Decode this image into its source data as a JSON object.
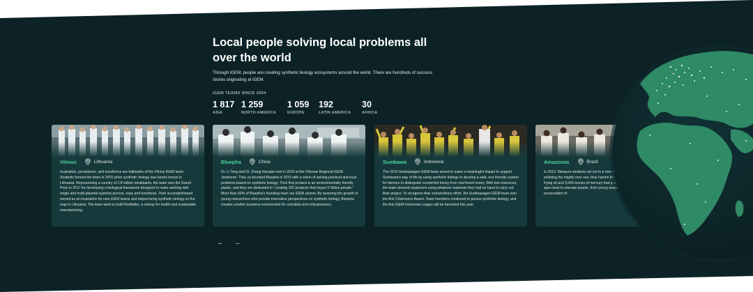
{
  "section": {
    "headline": "Local people solving local problems all over the world",
    "intro": "Through iGEM, people are creating synthetic biology ecosystems around the world. There are hundreds of success stories originating at iGEM."
  },
  "stats": {
    "label": "iGEM TEAMS SINCE 2004",
    "items": [
      {
        "value": "1 817",
        "region": "ASIA"
      },
      {
        "value": "1 259",
        "region": "NORTH AMERICA"
      },
      {
        "value": "1 059",
        "region": "EUROPE"
      },
      {
        "value": "192",
        "region": "LATIN AMERICA"
      },
      {
        "value": "30",
        "region": "AFRICA"
      }
    ]
  },
  "cards": [
    {
      "name": "Vilnius",
      "country": "Lithuania",
      "text": "Inspiration, persistence, and excellence are hallmarks of the Vilnius iGEM team. Students formed the team in 2015 when synthetic biology was barely known in Lithuania. Representing a country of 2.8 million inhabitants, the team won the Grand Prize in 2017 for developing a biological framework designed to make working with single and multi-plasmid systems precise, easy and functional. Their accomplishment served as an inspiration for new iGEM teams and helped bring synthetic biology on the map in Lithuania. The team went to build BioMatter, a startup for health and sustainable manufacturing."
    },
    {
      "name": "Bluepha",
      "country": "China",
      "text": "Dr. Li Teng and Dr. Zhang Haoqian met in 2010 at the Chinese Regional iGEM Jamboree. They co-founded Bluepha in 2015 with a vision of solving practical and local problems based on synthetic biology. Their first product is an environmentally friendly plastic, and they are dedicated to \"creating 100 products that impact 5 billion people.\" More than 50% of Bluepha's founding team are iGEM alumni. By nurturing the growth of young researchers who provide innovative perspectives on synthetic biology, Bluepha creates a better business environment for scientists and entrepreneurs."
    },
    {
      "name": "Sumbawa",
      "country": "Indonesia",
      "text": "The 2014 Sumbawagen iGEM team aimed to make a meaningful impact to support Sumbawa's way of life by using synthetic biology to develop a safe, eco-friendly system for farmers to distinguish counterfeit honey from real forest honey. With few resources, the team devised equipment using whatever materials they had on hand to carry out their project. To recognize their extraordinary effort, the Sumbawagen iGEM team won the first Chairman's Award. Team members continued to pursue synthetic biology, and the first iGEM Indonesia League will be launched this year."
    },
    {
      "name": "Amazonas",
      "country": "Brazil",
      "text": "In 2013, Manaura students set out to p river through synthetic biology. Over dec polluting the mighty river sea, thus harmin the ecosystem. The teams created solution frying oil and 3,000 tonnes of mercury that p addition to their technological work, they spen boat to educate people, from young students to biology, environmentalism, and the preservation of"
    }
  ],
  "nav": {
    "prev": "←",
    "next": "→"
  }
}
